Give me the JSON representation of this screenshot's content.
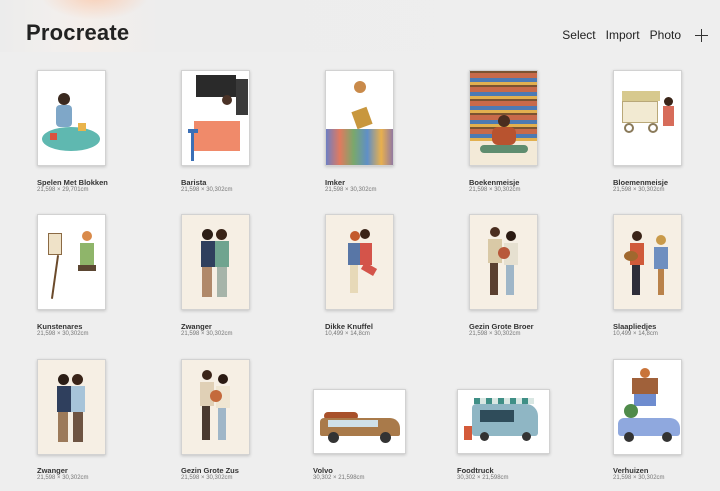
{
  "header": {
    "app_title": "Procreate",
    "select_label": "Select",
    "import_label": "Import",
    "photo_label": "Photo",
    "add_icon": "plus-icon"
  },
  "artworks": [
    {
      "title": "Spelen Met Blokken",
      "size": "21,598 × 29,701cm"
    },
    {
      "title": "Barista",
      "size": "21,598 × 30,302cm"
    },
    {
      "title": "Imker",
      "size": "21,598 × 30,302cm"
    },
    {
      "title": "Boekenmeisje",
      "size": "21,598 × 30,302cm"
    },
    {
      "title": "Bloemenmeisje",
      "size": "21,598 × 30,302cm"
    },
    {
      "title": "Kunstenares",
      "size": "21,598 × 30,302cm"
    },
    {
      "title": "Zwanger",
      "size": "21,598 × 30,302cm"
    },
    {
      "title": "Dikke Knuffel",
      "size": "10,499 × 14,8cm"
    },
    {
      "title": "Gezin Grote Broer",
      "size": "21,598 × 30,302cm"
    },
    {
      "title": "Slaapliedjes",
      "size": "10,499 × 14,8cm"
    },
    {
      "title": "Zwanger",
      "size": "21,598 × 30,302cm"
    },
    {
      "title": "Gezin Grote Zus",
      "size": "21,598 × 30,302cm"
    },
    {
      "title": "Volvo",
      "size": "30,302 × 21,598cm"
    },
    {
      "title": "Foodtruck",
      "size": "30,302 × 21,598cm"
    },
    {
      "title": "Verhuizen",
      "size": "21,598 × 30,302cm"
    }
  ]
}
